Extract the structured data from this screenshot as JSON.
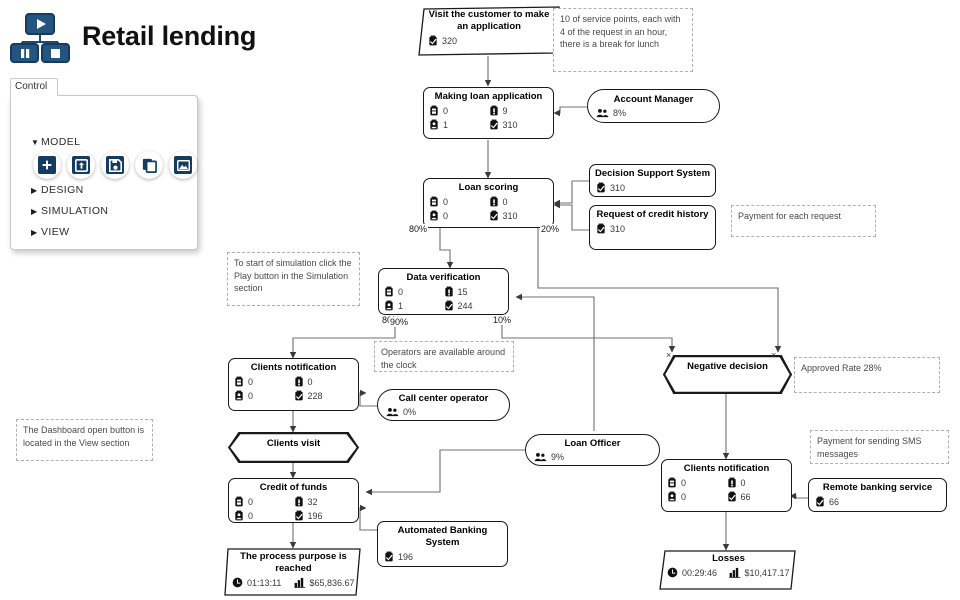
{
  "app": {
    "title": "Retail lending",
    "logo_icon": "process-model-logo-icon"
  },
  "control_panel": {
    "tab_label": "Control",
    "groups": [
      {
        "label": "MODEL",
        "expanded": true,
        "caret": "▼"
      },
      {
        "label": "DESIGN",
        "expanded": false,
        "caret": "▶"
      },
      {
        "label": "SIMULATION",
        "expanded": false,
        "caret": "▶"
      },
      {
        "label": "VIEW",
        "expanded": false,
        "caret": "▶"
      }
    ],
    "model_buttons": [
      {
        "name": "new-model-button",
        "icon": "plus-icon"
      },
      {
        "name": "open-model-button",
        "icon": "upload-icon"
      },
      {
        "name": "save-model-button",
        "icon": "floppy-save-icon"
      },
      {
        "name": "copy-model-button",
        "icon": "copy-icon"
      },
      {
        "name": "export-image-button",
        "icon": "image-icon"
      }
    ],
    "accent_color": "#143b61"
  },
  "diagram": {
    "nodes": {
      "visit_customer": {
        "title": "Visit the customer to make an application",
        "stats": [
          {
            "icon": "checkbox-icon",
            "value": "320"
          }
        ]
      },
      "making_loan_application": {
        "title": "Making loan application",
        "stats": [
          {
            "icon": "inbox-icon",
            "value": "0"
          },
          {
            "icon": "in-progress-icon",
            "value": "9"
          },
          {
            "icon": "person-icon",
            "value": "1"
          },
          {
            "icon": "checkbox-icon",
            "value": "310"
          }
        ]
      },
      "account_manager": {
        "title": "Account Manager",
        "stats": [
          {
            "icon": "people-icon",
            "value": "8%"
          }
        ]
      },
      "loan_scoring": {
        "title": "Loan scoring",
        "stats": [
          {
            "icon": "inbox-icon",
            "value": "0"
          },
          {
            "icon": "in-progress-icon",
            "value": "0"
          },
          {
            "icon": "person-icon",
            "value": "0"
          },
          {
            "icon": "checkbox-icon",
            "value": "310"
          }
        ]
      },
      "decision_support_system": {
        "title": "Decision Support System",
        "stats": [
          {
            "icon": "checkbox-icon",
            "value": "310"
          }
        ]
      },
      "request_of_credit_history": {
        "title": "Request of credit history",
        "stats": [
          {
            "icon": "checkbox-icon",
            "value": "310"
          }
        ]
      },
      "data_verification": {
        "title": "Data verification",
        "stats": [
          {
            "icon": "inbox-icon",
            "value": "0"
          },
          {
            "icon": "in-progress-icon",
            "value": "15"
          },
          {
            "icon": "person-icon",
            "value": "1"
          },
          {
            "icon": "checkbox-icon",
            "value": "244"
          }
        ]
      },
      "clients_notification_left": {
        "title": "Clients notification",
        "stats": [
          {
            "icon": "inbox-icon",
            "value": "0"
          },
          {
            "icon": "in-progress-icon",
            "value": "0"
          },
          {
            "icon": "person-icon",
            "value": "0"
          },
          {
            "icon": "checkbox-icon",
            "value": "228"
          }
        ]
      },
      "call_center_operator": {
        "title": "Call center operator",
        "stats": [
          {
            "icon": "people-icon",
            "value": "0%"
          }
        ]
      },
      "clients_visit": {
        "title": "Clients visit"
      },
      "credit_of_funds": {
        "title": "Credit of funds",
        "stats": [
          {
            "icon": "inbox-icon",
            "value": "0"
          },
          {
            "icon": "in-progress-icon",
            "value": "32"
          },
          {
            "icon": "person-icon",
            "value": "0"
          },
          {
            "icon": "checkbox-icon",
            "value": "196"
          }
        ]
      },
      "automated_banking_system": {
        "title": "Automated Banking System",
        "stats": [
          {
            "icon": "checkbox-icon",
            "value": "196"
          }
        ]
      },
      "process_purpose_reached": {
        "title": "The process purpose is reached",
        "stats": [
          {
            "icon": "clock-icon",
            "value": "01:13:11"
          },
          {
            "icon": "bar-chart-icon",
            "value": "$65,836.67"
          }
        ]
      },
      "loan_officer": {
        "title": "Loan Officer",
        "stats": [
          {
            "icon": "people-icon",
            "value": "9%"
          }
        ]
      },
      "negative_decision": {
        "title": "Negative decision"
      },
      "clients_notification_right": {
        "title": "Clients notification",
        "stats": [
          {
            "icon": "inbox-icon",
            "value": "0"
          },
          {
            "icon": "in-progress-icon",
            "value": "0"
          },
          {
            "icon": "person-icon",
            "value": "0"
          },
          {
            "icon": "checkbox-icon",
            "value": "66"
          }
        ]
      },
      "remote_banking_service": {
        "title": "Remote banking service",
        "stats": [
          {
            "icon": "checkbox-icon",
            "value": "66"
          }
        ]
      },
      "losses": {
        "title": "Losses",
        "stats": [
          {
            "icon": "clock-icon",
            "value": "00:29:46"
          },
          {
            "icon": "bar-chart-icon",
            "value": "$10,417.17"
          }
        ]
      }
    },
    "edge_labels": {
      "scoring_to_verification": "80%",
      "scoring_to_negative": "20%",
      "verification_to_notification": "90%",
      "verification_back": "10%",
      "x_left": "×",
      "x_right": "×"
    },
    "notes": {
      "service_points": "10 of service points, each with 4 of the request in an hour, there is a break for lunch",
      "payment_each_request": "Payment for each request",
      "start_simulation": "To start of simulation click the Play button in the Simulation section",
      "operators_clock": "Operators are available around the clock",
      "dashboard_open": "The Dashboard open button is located in the View section",
      "approved_rate": "Approved Rate 28%",
      "payment_sms": "Payment for sending SMS messages"
    }
  }
}
